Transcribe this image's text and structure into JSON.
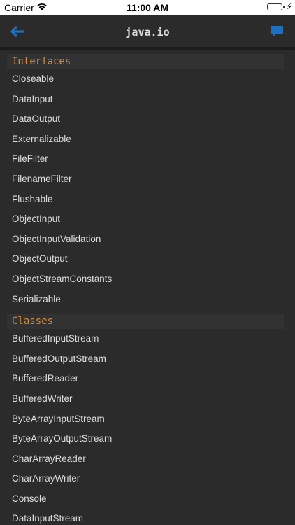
{
  "status": {
    "carrier": "Carrier",
    "time": "11:00 AM",
    "battery_level": 1.0
  },
  "nav": {
    "title": "java.io",
    "back_icon": "back-arrow-icon",
    "chat_icon": "chat-bubble-icon",
    "accent": "#1e6fc1"
  },
  "sections": [
    {
      "title": "Interfaces",
      "items": [
        "Closeable",
        "DataInput",
        "DataOutput",
        "Externalizable",
        "FileFilter",
        "FilenameFilter",
        "Flushable",
        "ObjectInput",
        "ObjectInputValidation",
        "ObjectOutput",
        "ObjectStreamConstants",
        "Serializable"
      ]
    },
    {
      "title": "Classes",
      "items": [
        "BufferedInputStream",
        "BufferedOutputStream",
        "BufferedReader",
        "BufferedWriter",
        "ByteArrayInputStream",
        "ByteArrayOutputStream",
        "CharArrayReader",
        "CharArrayWriter",
        "Console",
        "DataInputStream"
      ]
    }
  ]
}
